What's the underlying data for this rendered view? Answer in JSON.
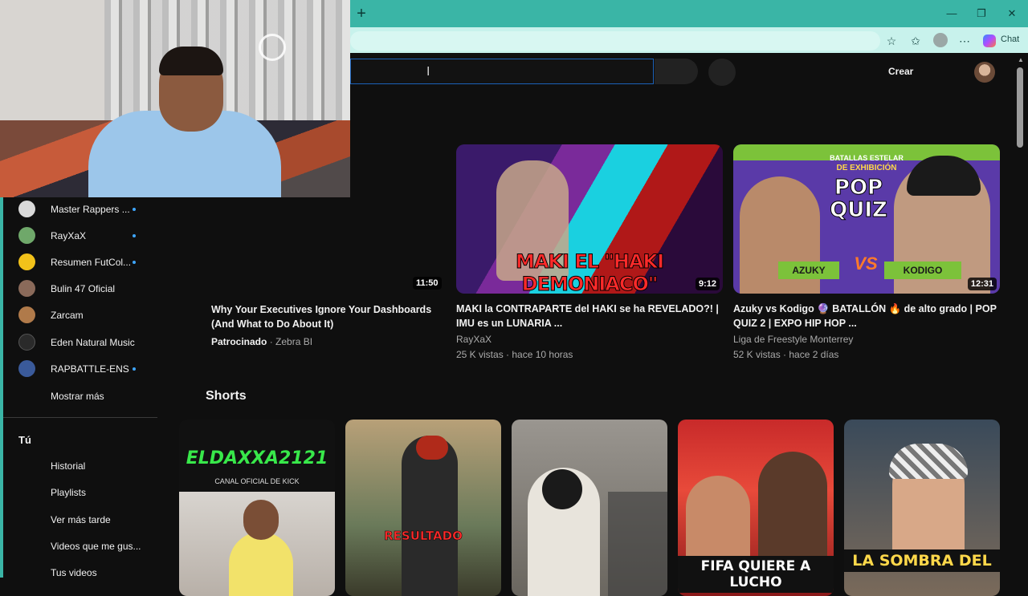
{
  "browser": {
    "new_tab_glyph": "+",
    "window_controls": [
      "—",
      "❐",
      "✕"
    ],
    "toolbar_icons": [
      "star-icon",
      "favorites-icon",
      "profile-icon",
      "more-icon"
    ],
    "copilot_label": "Chat"
  },
  "youtube": {
    "create_label": "Crear",
    "sidebar": {
      "subscriptions": [
        {
          "label": "Master Rappers ...",
          "new": true,
          "color": "#d9d9d9"
        },
        {
          "label": "RayXaX",
          "new": true,
          "color": "#6fa86a"
        },
        {
          "label": "Resumen FutCol...",
          "new": true,
          "color": "#f2c21a"
        },
        {
          "label": "Bulin 47 Oficial",
          "new": false,
          "color": "#8a6a5a"
        },
        {
          "label": "Zarcam",
          "new": false,
          "color": "#b07a4a"
        },
        {
          "label": "Eden Natural Music",
          "new": false,
          "color": "#2a2a2a"
        },
        {
          "label": "RAPBATTLE-ENS",
          "new": true,
          "color": "#3a5a9a"
        }
      ],
      "show_more": "Mostrar más",
      "you_section": "Tú",
      "you_items": [
        "Historial",
        "Playlists",
        "Ver más tarde",
        "Videos que me gus...",
        "Tus videos"
      ]
    },
    "ad": {
      "duration": "11:50",
      "title": "Why Your Executives Ignore Your Dashboards (And What to Do About It)",
      "sponsored": "Patrocinado",
      "advertiser": "· Zebra BI"
    },
    "videos": [
      {
        "thumb_text": "MAKI EL \"HAKI DEMONIACO\"",
        "duration": "9:12",
        "title": "MAKI la CONTRAPARTE del HAKI se ha REVELADO?! | IMU es un LUNARIA ...",
        "channel": "RayXaX",
        "stats": "25 K vistas · hace 10 horas"
      },
      {
        "thumb_header": "BATALLAS ESTELAR",
        "thumb_sub": "DE EXHIBICIÓN",
        "thumb_logo": "POP QUIZ",
        "thumb_left": "AZUKY",
        "thumb_right": "KODIGO",
        "thumb_vs": "VS",
        "duration": "12:31",
        "title": "Azuky vs Kodigo 🔮 BATALLÓN 🔥 de alto grado | POP QUIZ 2 | EXPO HIP HOP ...",
        "channel": "Liga de Freestyle Monterrey",
        "stats": "52 K vistas · hace 2 días"
      }
    ],
    "shorts_heading": "Shorts",
    "shorts": [
      {
        "caption": "ELDAXXA2121",
        "sub": "CANAL OFICIAL DE KICK"
      },
      {
        "caption": "RESULTADO"
      },
      {
        "caption": ""
      },
      {
        "caption": "FIFA QUIERE A LUCHO"
      },
      {
        "caption": "LA SOMBRA DEL"
      }
    ]
  }
}
